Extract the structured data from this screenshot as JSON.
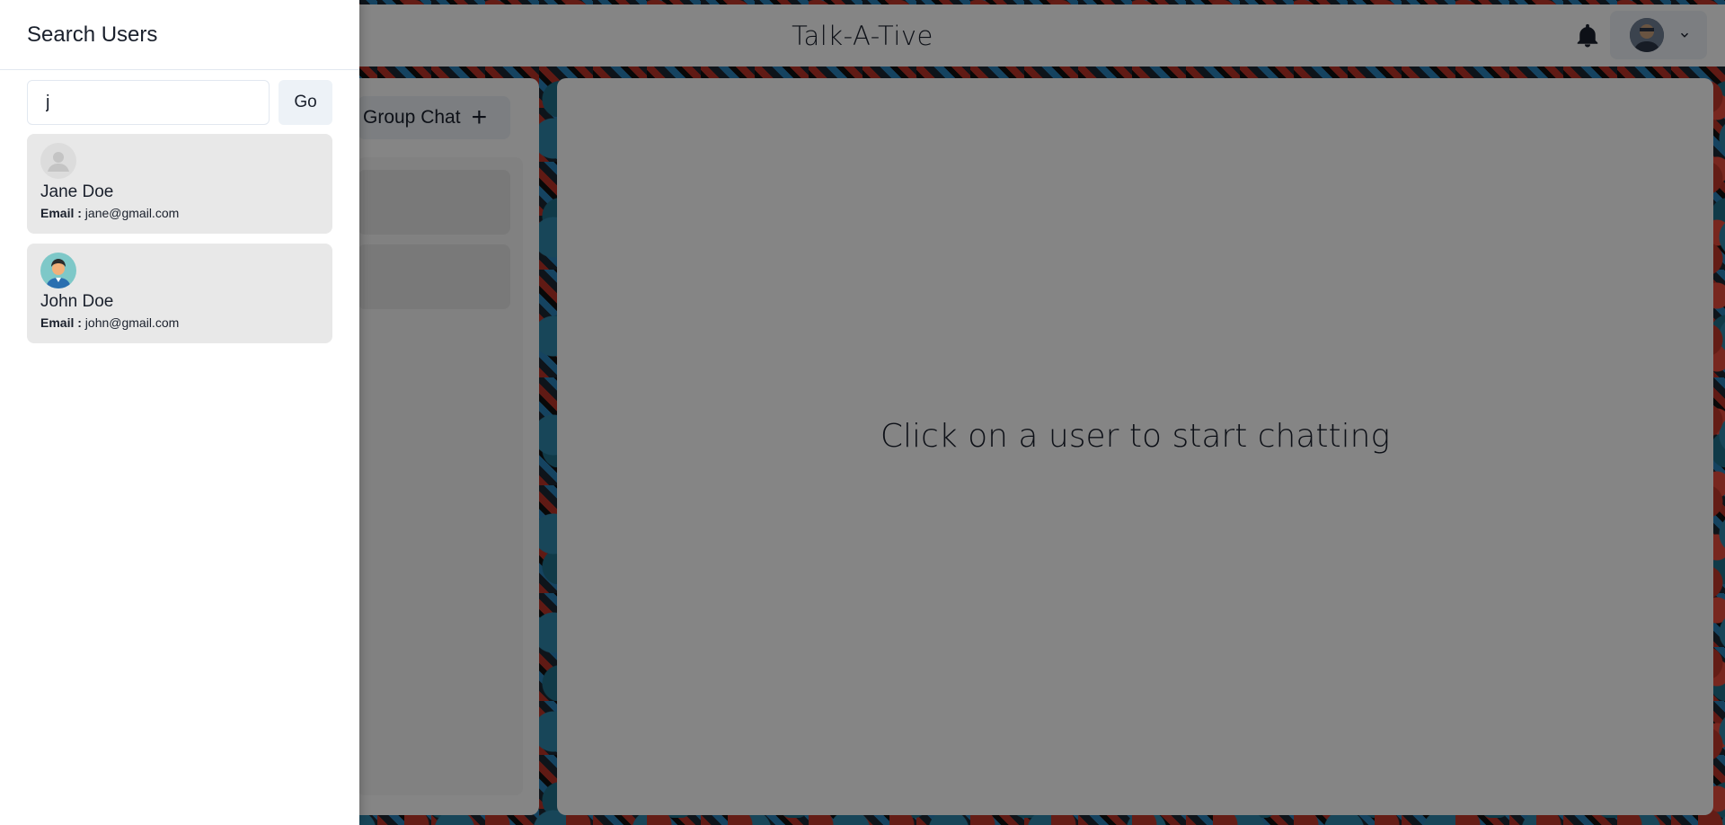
{
  "app": {
    "title": "Talk-A-Tive"
  },
  "header": {
    "bell_icon": "bell-icon",
    "profile_chevron_icon": "chevron-down-icon"
  },
  "left_panel": {
    "group_chat_label": "Group Chat",
    "group_chat_icon": "plus-icon"
  },
  "main": {
    "empty_message": "Click on a user to start chatting"
  },
  "drawer": {
    "title": "Search Users",
    "search": {
      "value": "j",
      "placeholder": ""
    },
    "go_label": "Go",
    "results": [
      {
        "name": "Jane Doe",
        "email_label": "Email :",
        "email": "jane@gmail.com",
        "avatar": "default-avatar"
      },
      {
        "name": "John Doe",
        "email_label": "Email :",
        "email": "john@gmail.com",
        "avatar": "man-avatar"
      }
    ]
  }
}
